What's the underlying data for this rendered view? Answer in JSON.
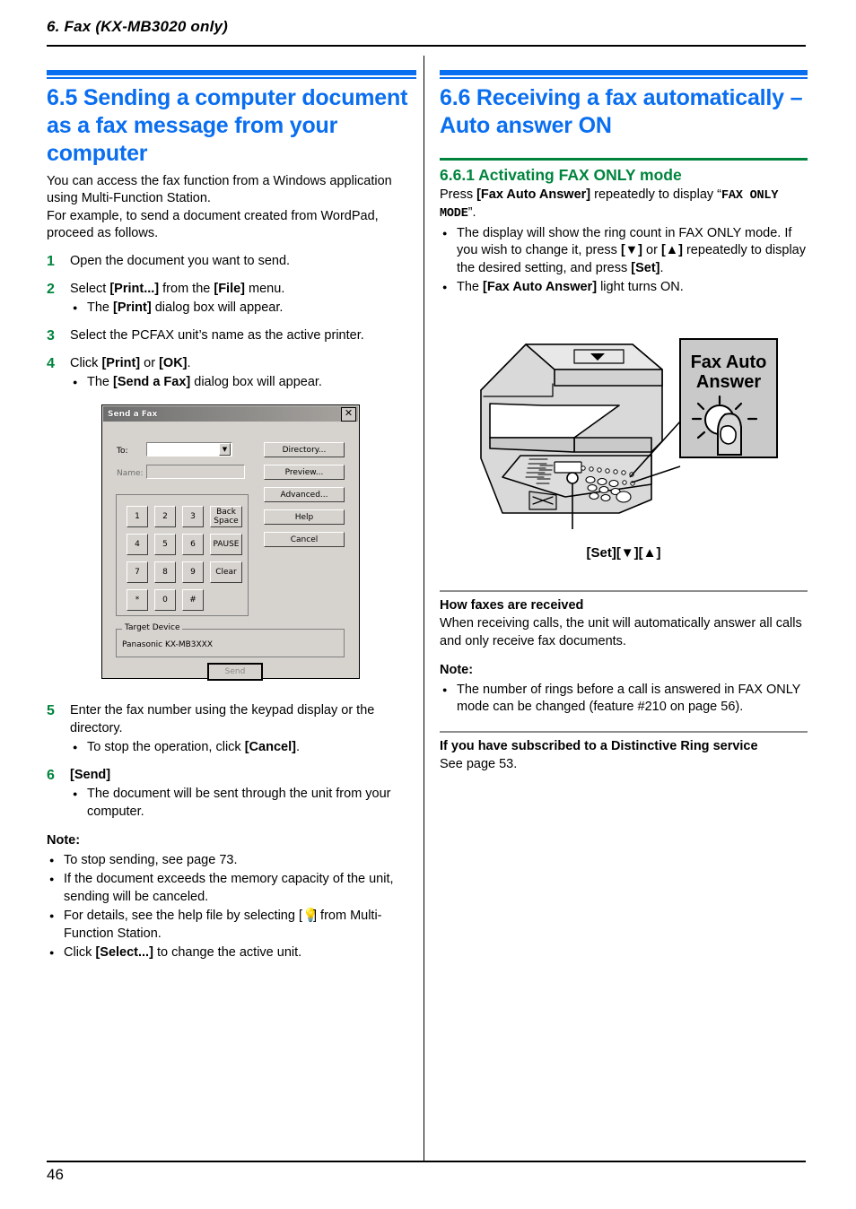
{
  "running_head": "6. Fax (KX-MB3020 only)",
  "page_number": "46",
  "colors": {
    "heading_blue": "#0a6ef0",
    "heading_green": "#00843d",
    "rule_grey": "#8e8e8e"
  },
  "left_column": {
    "section_number_title": "6.5 Sending a computer document as a fax message from your computer",
    "intro_paragraph_1": "You can access the fax function from a Windows application using Multi-Function Station.",
    "intro_paragraph_2": "For example, to send a document created from WordPad, proceed as follows.",
    "steps": [
      {
        "num": "1",
        "text": "Open the document you want to send.",
        "bullets": []
      },
      {
        "num": "2",
        "text_parts": [
          "Select ",
          "[Print...]",
          " from the ",
          "[File]",
          " menu."
        ],
        "bullets": [
          {
            "parts": [
              "The ",
              "[Print]",
              " dialog box will appear."
            ]
          }
        ]
      },
      {
        "num": "3",
        "text": "Select the PCFAX unit’s name as the active printer.",
        "bullets": []
      },
      {
        "num": "4",
        "text_parts": [
          "Click ",
          "[Print]",
          " or ",
          "[OK]",
          "."
        ],
        "bullets": [
          {
            "parts": [
              "The ",
              "[Send a Fax]",
              " dialog box will appear."
            ]
          }
        ]
      }
    ],
    "steps_after": [
      {
        "num": "5",
        "text": "Enter the fax number using the keypad display or the directory.",
        "bullets": [
          {
            "parts": [
              "To stop the operation, click ",
              "[Cancel]",
              "."
            ]
          }
        ]
      },
      {
        "num": "6",
        "text_parts": [
          "",
          "[Send]",
          ""
        ],
        "bullets": [
          {
            "parts": [
              "The document will be sent through the unit from your computer."
            ]
          }
        ]
      }
    ],
    "note_label": "Note:",
    "notes": [
      {
        "parts": [
          "To stop sending, see page 73."
        ]
      },
      {
        "parts": [
          "If the document exceeds the memory capacity of the unit, sending will be canceled."
        ]
      },
      {
        "parts": [
          "For details, see the help file by selecting [ Ὂ1 ] from Multi-Function Station."
        ]
      },
      {
        "parts": [
          "Click ",
          "[Select...]",
          " to change the active unit."
        ]
      }
    ],
    "notes_plain": [
      "To stop sending, see page 73.",
      "If the document exceeds the memory capacity of the unit, sending will be canceled.",
      "For details, see the help file by selecting [ ] from Multi-Function Station.",
      "Click [Select...] to change the active unit."
    ]
  },
  "dialog": {
    "title": "Send a Fax",
    "close_label": "✕",
    "to_label": "To:",
    "to_value": "",
    "name_label": "Name:",
    "name_value": "",
    "keypad": [
      "1",
      "2",
      "3",
      "4",
      "5",
      "6",
      "7",
      "8",
      "9",
      "*",
      "0",
      "#"
    ],
    "keypad_side": [
      "Back Space",
      "PAUSE",
      "Clear"
    ],
    "side_buttons": [
      "Directory...",
      "Preview...",
      "Advanced...",
      "Help",
      "Cancel"
    ],
    "target_device_label": "Target Device",
    "target_device_value": "Panasonic KX-MB3XXX",
    "send_label": "Send"
  },
  "right_column": {
    "section_number_title": "6.6 Receiving a fax automatically – Auto answer ON",
    "subsection_title": "6.6.1 Activating FAX ONLY mode",
    "intro_parts": {
      "lead": "Press ",
      "key": "[Fax Auto Answer]",
      "mid": " repeatedly to display “",
      "display": "FAX ONLY MODE",
      "tail": "”."
    },
    "bullets": [
      "The display will show the ring count in FAX ONLY mode. If you wish to change it, press [▼] or [▲] repeatedly to display the desired setting, and press [Set].",
      "The [Fax Auto Answer] light turns ON."
    ],
    "illustration": {
      "callout_line1": "Fax Auto",
      "callout_line2": "Answer",
      "caption": "[Set][▼][▲]"
    },
    "how_heading": "How faxes are received",
    "how_text": "When receiving calls, the unit will automatically answer all calls and only receive fax documents.",
    "note_label": "Note:",
    "notes": [
      "The number of rings before a call is answered in FAX ONLY mode can be changed (feature #210 on page 56)."
    ],
    "distinctive_heading": "If you have subscribed to a Distinctive Ring service",
    "distinctive_text": "See page 53."
  }
}
